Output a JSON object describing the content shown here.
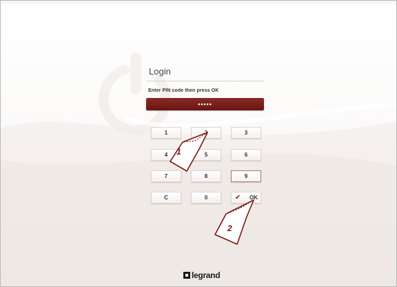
{
  "login": {
    "title": "Login",
    "instruction": "Enter PIN code then press OK",
    "pin_value": "•••••"
  },
  "keypad": {
    "keys": [
      "1",
      "2",
      "3",
      "4",
      "5",
      "6",
      "7",
      "8",
      "9",
      "C",
      "0",
      "OK"
    ]
  },
  "callouts": {
    "step1": "1",
    "step2": "2"
  },
  "brand": {
    "name": "legrand"
  },
  "colors": {
    "accent": "#7a1a17",
    "background": "#f6f2f0"
  }
}
